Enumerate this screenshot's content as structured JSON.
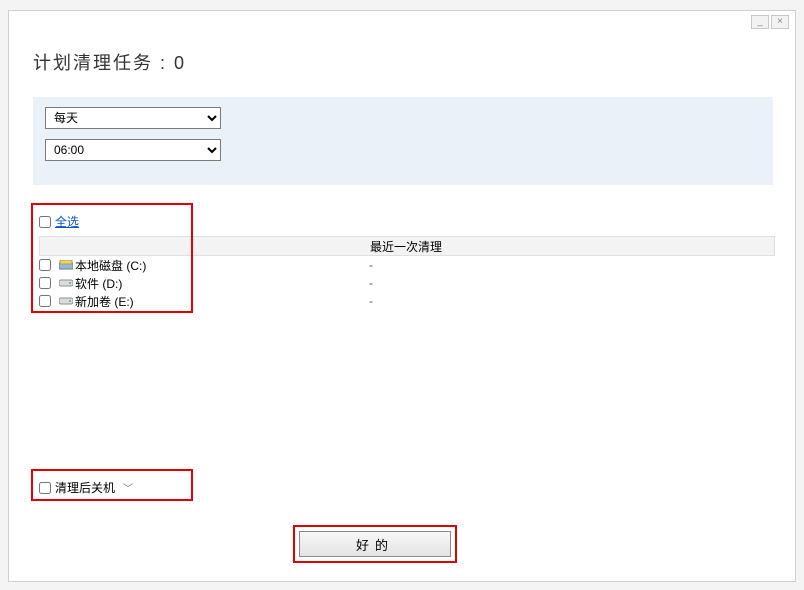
{
  "window": {
    "minimize": "_",
    "close": "×"
  },
  "title": "计划清理任务 : 0",
  "schedule": {
    "frequency": "每天",
    "time": "06:00"
  },
  "grid": {
    "select_all": "全选",
    "col_last": "最近一次清理",
    "rows": [
      {
        "name": "本地磁盘 (C:)",
        "last": "-",
        "icon": "disk-c"
      },
      {
        "name": "软件 (D:)",
        "last": "-",
        "icon": "disk"
      },
      {
        "name": "新加卷 (E:)",
        "last": "-",
        "icon": "disk"
      }
    ]
  },
  "shutdown": {
    "label": "清理后关机"
  },
  "ok": "好的"
}
